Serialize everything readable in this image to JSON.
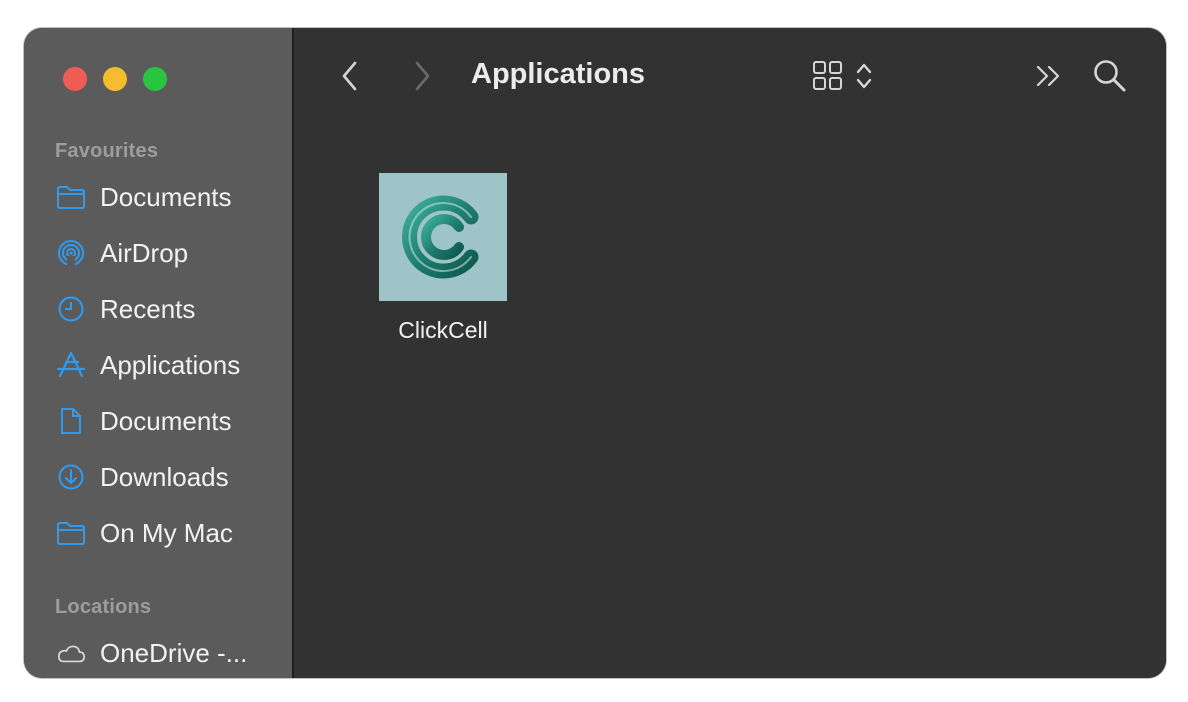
{
  "window": {
    "title": "Applications",
    "traffic_lights": {
      "close_color": "#ee5c55",
      "minimize_color": "#f6bc2f",
      "zoom_color": "#29c440"
    }
  },
  "sidebar": {
    "favourites_header": "Favourites",
    "favourites": [
      {
        "label": "Documents",
        "icon": "folder-icon"
      },
      {
        "label": "AirDrop",
        "icon": "airdrop-icon"
      },
      {
        "label": "Recents",
        "icon": "clock-icon"
      },
      {
        "label": "Applications",
        "icon": "applications-icon"
      },
      {
        "label": "Documents",
        "icon": "document-icon"
      },
      {
        "label": "Downloads",
        "icon": "download-icon"
      },
      {
        "label": "On My Mac",
        "icon": "folder-icon"
      }
    ],
    "locations_header": "Locations",
    "locations": [
      {
        "label": "OneDrive -...",
        "icon": "cloud-icon"
      }
    ],
    "accent_color": "#2e9bf0"
  },
  "toolbar": {
    "back_icon": "chevron-left-icon",
    "forward_icon": "chevron-right-icon",
    "view_icon": "grid-view-icon",
    "view_options_icon": "up-down-chevron-icon",
    "more_icon": "double-chevron-icon",
    "search_icon": "search-icon"
  },
  "files": [
    {
      "name": "ClickCell",
      "icon": "clickcell-app-icon"
    }
  ]
}
